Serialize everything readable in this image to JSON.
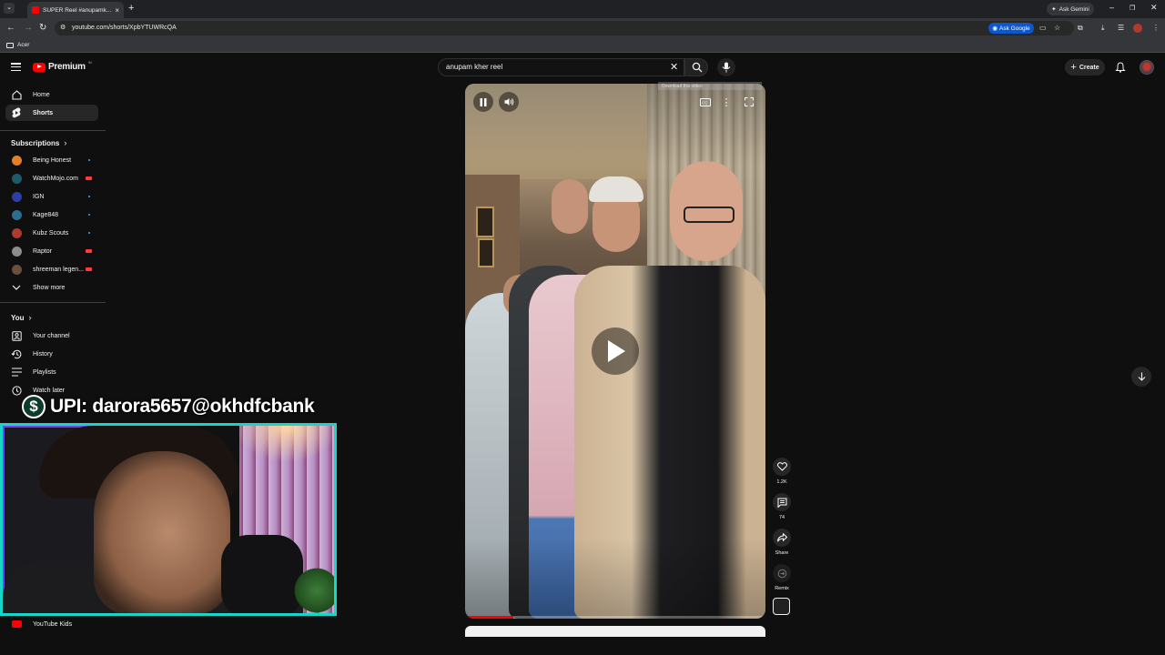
{
  "browser": {
    "tab_title": "SUPER Reel #anupamk...",
    "ask_gemini": "Ask Gemini",
    "url": "youtube.com/shorts/XpbYTUWRcQA",
    "ask_google": "Ask Google",
    "bookmark": "Acer"
  },
  "header": {
    "logo_text": "Premium",
    "logo_badge": "IN",
    "search_value": "anupam kher reel",
    "create_label": "Create"
  },
  "sidebar": {
    "nav": [
      {
        "label": "Home",
        "icon": "home-icon"
      },
      {
        "label": "Shorts",
        "icon": "shorts-icon"
      }
    ],
    "subscriptions_heading": "Subscriptions",
    "subscriptions": [
      {
        "label": "Being Honest",
        "color": "#e67e22",
        "status": "new"
      },
      {
        "label": "WatchMojo.com",
        "color": "#1f5a6b",
        "status": "live"
      },
      {
        "label": "IGN",
        "color": "#2c3ea8",
        "status": "new"
      },
      {
        "label": "Kage848",
        "color": "#2a6f8f",
        "status": "new"
      },
      {
        "label": "Kubz Scouts",
        "color": "#b03a2e",
        "status": "new"
      },
      {
        "label": "Raptor",
        "color": "#8c8c8c",
        "status": "live"
      },
      {
        "label": "shreeman legen...",
        "color": "#6b4f3a",
        "status": "live"
      }
    ],
    "show_more": "Show more",
    "you_heading": "You",
    "you_items": [
      {
        "label": "Your channel",
        "icon": "channel-icon"
      },
      {
        "label": "History",
        "icon": "history-icon"
      },
      {
        "label": "Playlists",
        "icon": "playlists-icon"
      },
      {
        "label": "Watch later",
        "icon": "watch-later-icon"
      }
    ],
    "youtube_kids": "YouTube Kids"
  },
  "short": {
    "download_overlay": "Download this video",
    "progress": 0.16,
    "likes": "1.2K",
    "comments": "74",
    "share_label": "Share",
    "remix_label": "Remix"
  },
  "overlay": {
    "upi_text": "UPI: darora5657@okhdfcbank",
    "upi_symbol": "$"
  },
  "colors": {
    "accent_red": "#ff0000",
    "webcam_border": "#18d6c7",
    "live_red": "#ff3b3b",
    "new_dot": "#3ea6ff"
  }
}
